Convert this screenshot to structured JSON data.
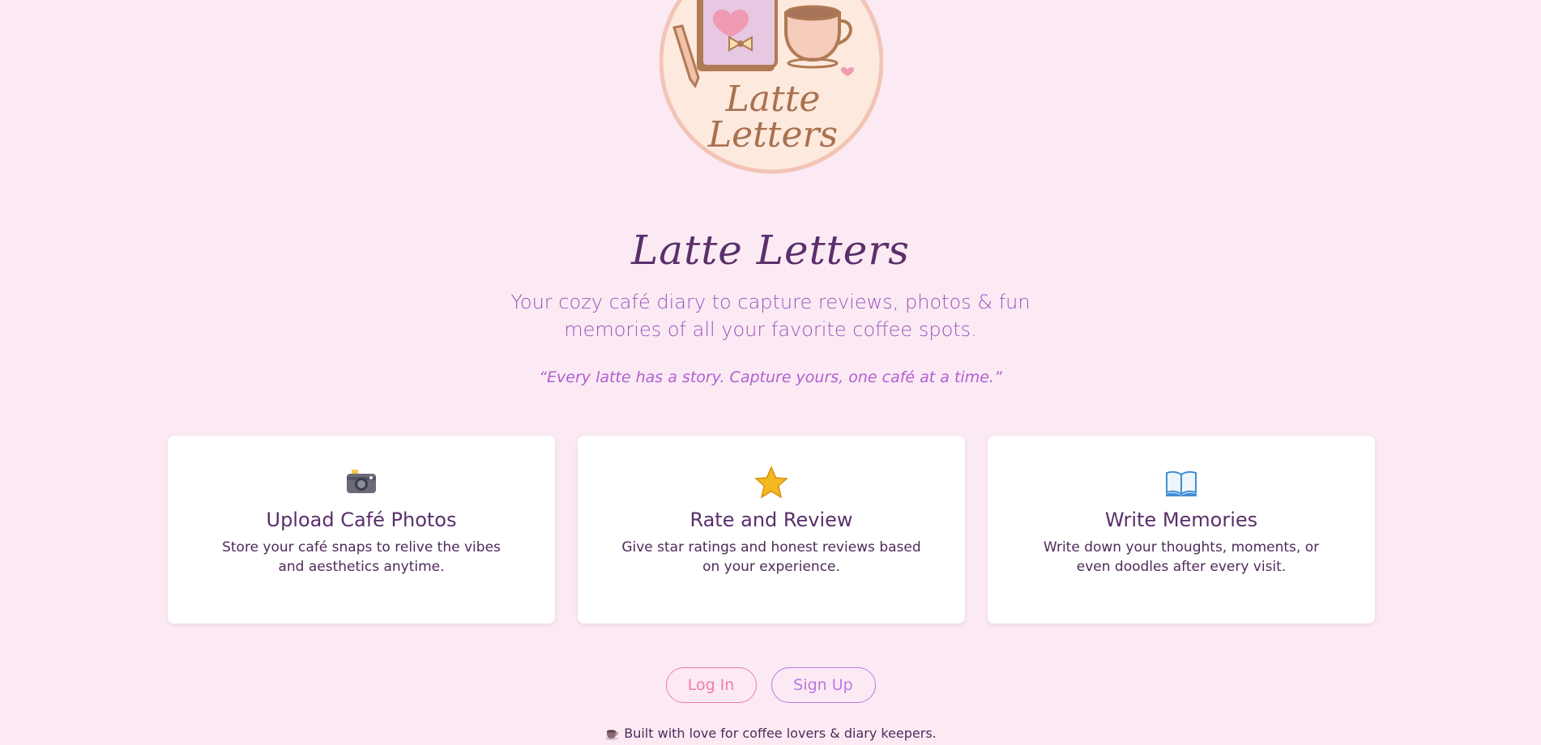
{
  "logo": {
    "text_line1": "Latte",
    "text_line2": "Letters"
  },
  "hero": {
    "title": "Latte Letters",
    "tagline": "Your cozy café diary to capture reviews, photos & fun memories of all your favorite coffee spots.",
    "quote": "“Every latte has a story. Capture yours, one café at a time.”"
  },
  "features": [
    {
      "icon": "camera-icon",
      "title": "Upload Café Photos",
      "description": "Store your café snaps to relive the vibes and aesthetics anytime."
    },
    {
      "icon": "star-icon",
      "title": "Rate and Review",
      "description": "Give star ratings and honest reviews based on your experience."
    },
    {
      "icon": "open-book-icon",
      "title": "Write Memories",
      "description": "Write down your thoughts, moments, or even doodles after every visit."
    }
  ],
  "auth": {
    "login_label": "Log In",
    "signup_label": "Sign Up"
  },
  "footer": {
    "icon": "coffee-cup-icon",
    "text": "Built with love for coffee lovers & diary keepers."
  },
  "colors": {
    "background": "#fbeaf3",
    "title": "#5a2f6b",
    "tagline": "#9a56bf",
    "quote": "#b05ed4",
    "login_accent": "#ef7ca9",
    "signup_accent": "#b979e3"
  }
}
